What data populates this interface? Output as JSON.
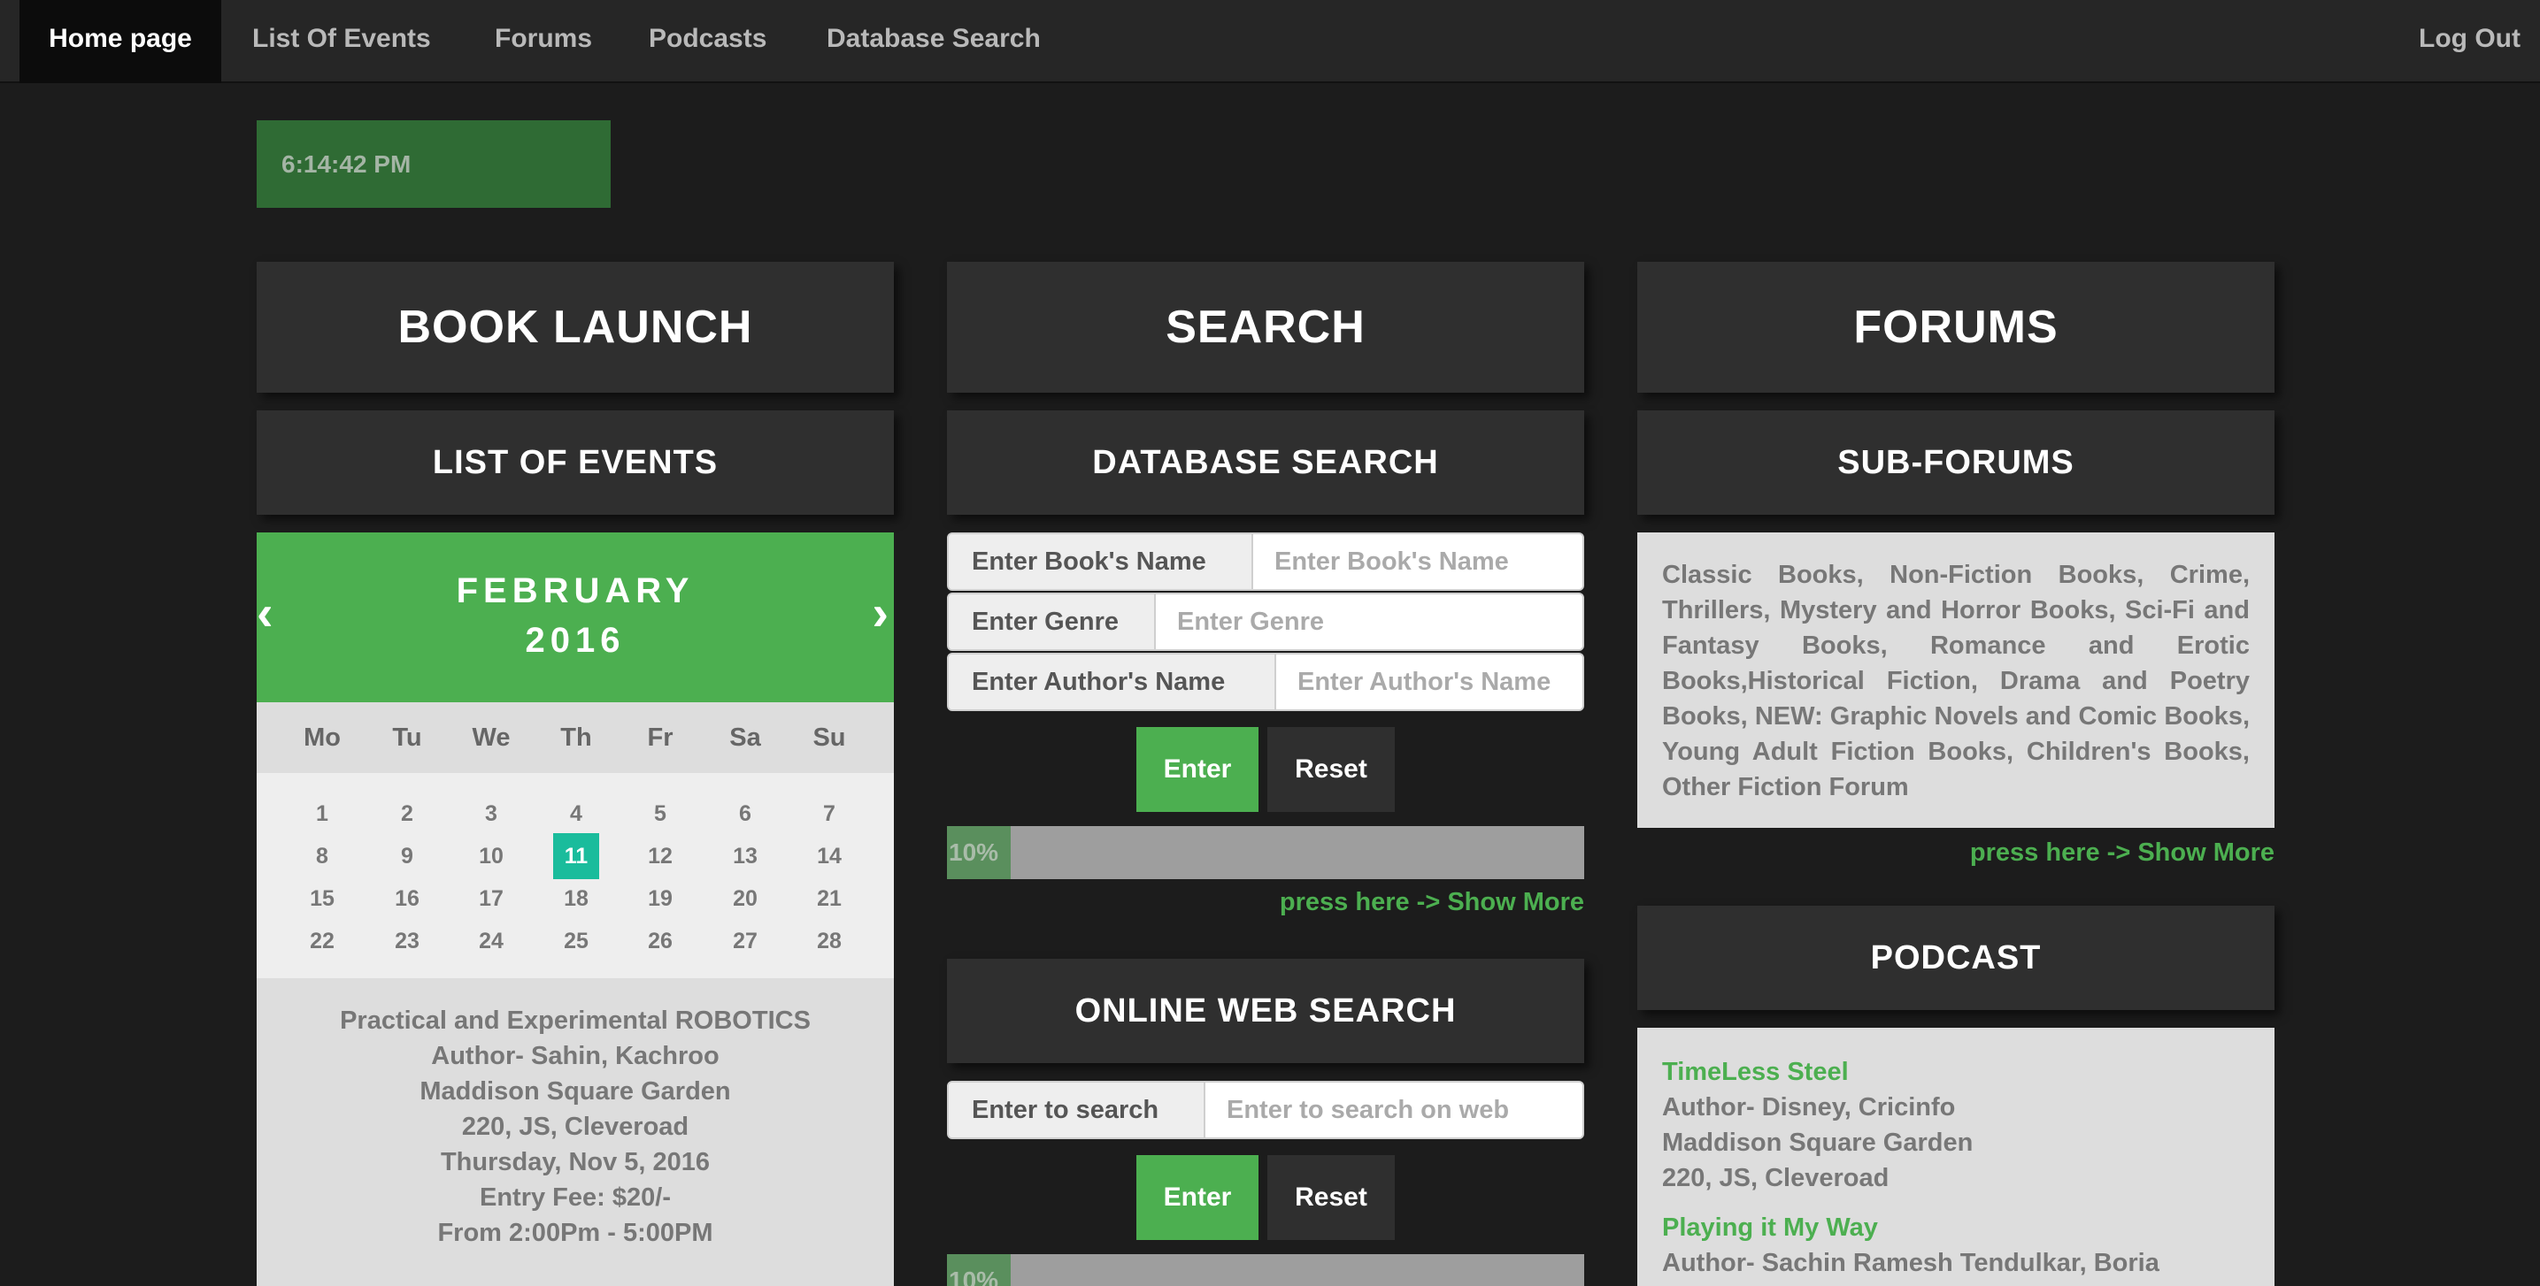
{
  "nav": {
    "home": "Home page",
    "events": "List Of Events",
    "forums": "Forums",
    "podcasts": "Podcasts",
    "database": "Database Search",
    "logout": "Log Out"
  },
  "clock": "6:14:42 PM",
  "book_launch": {
    "title": "BOOK LAUNCH",
    "subtitle": "LIST OF EVENTS"
  },
  "calendar": {
    "prev": "‹",
    "next": "›",
    "month": "FEBRUARY",
    "year": "2016",
    "weekdays": [
      "Mo",
      "Tu",
      "We",
      "Th",
      "Fr",
      "Sa",
      "Su"
    ],
    "weeks": [
      [
        "1",
        "2",
        "3",
        "4",
        "5",
        "6",
        "7"
      ],
      [
        "8",
        "9",
        "10",
        "11",
        "12",
        "13",
        "14"
      ],
      [
        "15",
        "16",
        "17",
        "18",
        "19",
        "20",
        "21"
      ],
      [
        "22",
        "23",
        "24",
        "25",
        "26",
        "27",
        "28"
      ]
    ],
    "today": "11"
  },
  "event": {
    "lines": [
      "Practical and Experimental ROBOTICS",
      "Author- Sahin, Kachroo",
      "Maddison Square Garden",
      "220, JS, Cleveroad",
      "Thursday, Nov 5, 2016",
      "Entry Fee: $20/-",
      "From 2:00Pm - 5:00PM"
    ]
  },
  "search": {
    "title": "SEARCH",
    "db_title": "DATABASE SEARCH",
    "book_label": "Enter Book's Name",
    "book_placeholder": "Enter Book's Name",
    "genre_label": "Enter Genre",
    "genre_placeholder": "Enter Genre",
    "author_label": "Enter Author's Name",
    "author_placeholder": "Enter Author's Name",
    "enter": "Enter",
    "reset": "Reset",
    "progress_text": "10%",
    "progress_value": 10,
    "show_more": "press here -> Show More",
    "web_title": "ONLINE WEB SEARCH",
    "web_label": "Enter to search",
    "web_placeholder": "Enter to search on web",
    "web_enter": "Enter",
    "web_reset": "Reset",
    "web_progress_text": "10%",
    "web_progress_value": 10
  },
  "forums": {
    "title": "FORUMS",
    "sub_title": "SUB-FORUMS",
    "list": "Classic Books, Non-Fiction Books, Crime, Thrillers, Mystery and Horror Books, Sci-Fi and Fantasy Books, Romance and Erotic Books,Historical Fiction, Drama and Poetry Books, NEW: Graphic Novels and Comic Books, Young Adult Fiction Books, Children's Books, Other Fiction Forum",
    "show_more": "press here -> Show More"
  },
  "podcast": {
    "title": "PODCAST",
    "items": [
      {
        "name": "TimeLess Steel",
        "author": "Author- Disney, Cricinfo",
        "venue": "Maddison Square Garden",
        "address": "220, JS, Cleveroad"
      },
      {
        "name": "Playing it My Way",
        "author": "Author- Sachin Ramesh Tendulkar, Boria"
      }
    ]
  }
}
